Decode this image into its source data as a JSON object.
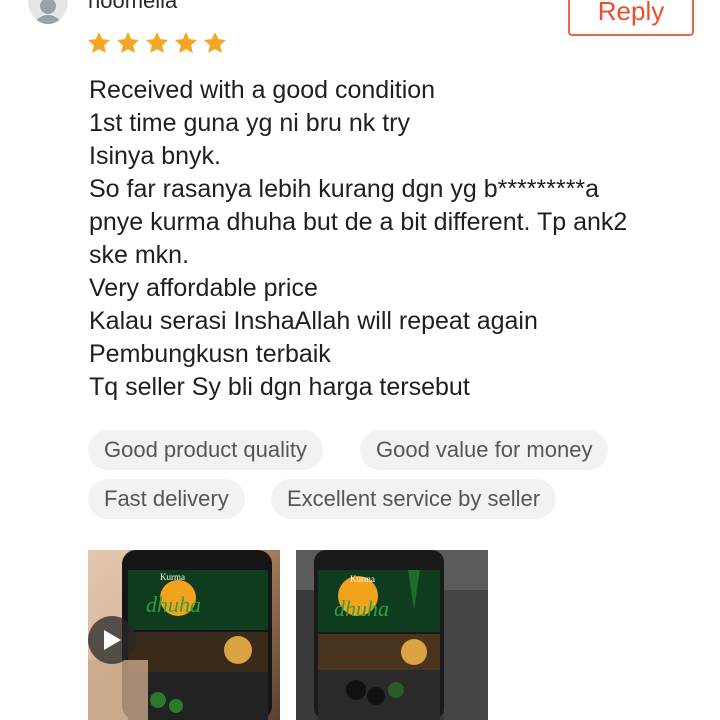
{
  "reviewer": {
    "name": "noomelia"
  },
  "reply_label": "Reply",
  "rating": {
    "value": 5,
    "max": 5
  },
  "review_lines": [
    "Received with a good condition",
    "1st time guna yg ni bru nk try",
    "Isinya bnyk.",
    "So far rasanya lebih kurang dgn yg b*********a",
    "pnye kurma dhuha but de a bit different. Tp ank2",
    "ske mkn.",
    "Very affordable price",
    "Kalau serasi InshaAllah will repeat again",
    "Pembungkusn terbaik",
    "Tq seller Sy bli dgn harga tersebut"
  ],
  "tags": [
    "Good product quality",
    "Good value for money",
    "Fast delivery",
    "Excellent service by seller"
  ],
  "media": [
    {
      "kind": "video",
      "icon": "play-icon",
      "label_text": "Kurma dhuha"
    },
    {
      "kind": "photo",
      "label_text": "Kurma dhuha"
    }
  ],
  "colors": {
    "accent": "#ee4d2d",
    "star": "#f6a623",
    "tag_bg": "#f2f2f2",
    "tag_text": "#555555"
  }
}
